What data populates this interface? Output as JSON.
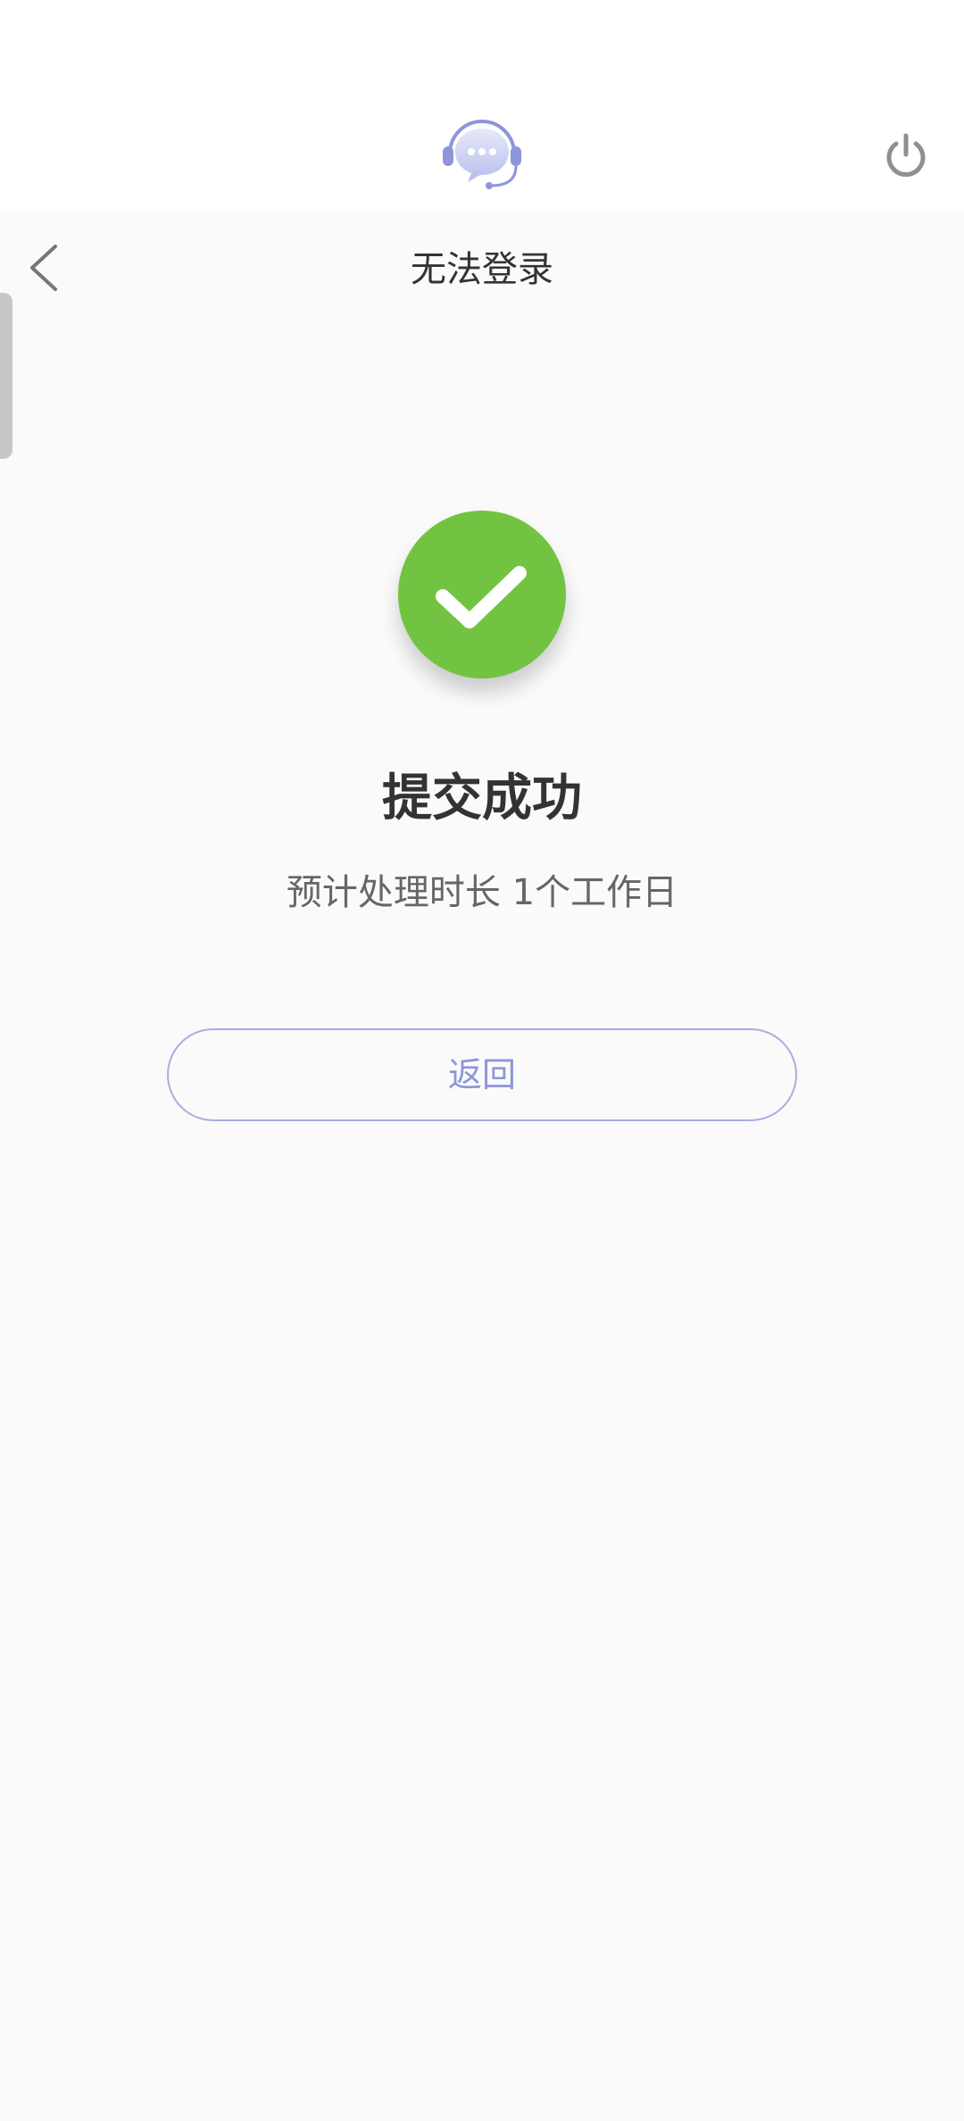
{
  "header": {
    "assistant_icon": "headset-chat-icon",
    "power_icon": "power-icon",
    "accent_color": "#8c96d8"
  },
  "nav": {
    "back_icon": "chevron-left-icon",
    "title": "无法登录"
  },
  "result": {
    "status_icon": "check-circle-icon",
    "status_color": "#72c342",
    "title": "提交成功",
    "subtitle": "预计处理时长 1个工作日"
  },
  "actions": {
    "return_label": "返回"
  }
}
